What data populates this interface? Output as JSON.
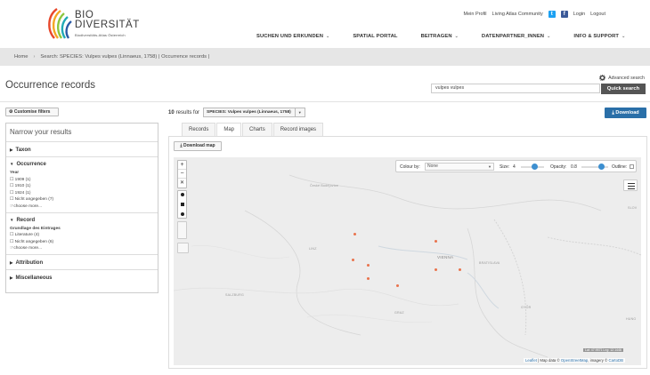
{
  "brand": {
    "name_line1": "BIO",
    "name_line2": "DIVERSITÄT",
    "subtitle": "Biodiversitäts-Atlas Österreich"
  },
  "util_nav": {
    "profile": "Mein Profil",
    "community": "Living Atlas Community",
    "twitter_glyph": "t",
    "facebook_glyph": "f",
    "login": "Login",
    "logout": "Logout"
  },
  "main_nav": {
    "items": [
      {
        "label": "SUCHEN UND ERKUNDEN",
        "chevron": "⌄"
      },
      {
        "label": "SPATIAL PORTAL",
        "chevron": ""
      },
      {
        "label": "BEITRAGEN",
        "chevron": "⌄"
      },
      {
        "label": "DATENPARTNER_INNEN",
        "chevron": "⌄"
      },
      {
        "label": "INFO & SUPPORT",
        "chevron": "⌄"
      }
    ]
  },
  "breadcrumb": {
    "home": "Home",
    "current": "Search: SPECIES: Vulpes vulpes (Linnaeus, 1758) | Occurrence records |"
  },
  "page": {
    "title": "Occurrence records"
  },
  "search": {
    "advanced_label": "Advanced search",
    "query": "vulpes vulpes",
    "button": "Quick search"
  },
  "sidebar": {
    "customise_label": "Customise filters",
    "narrow_title": "Narrow your results",
    "taxon": "Taxon",
    "occurrence": {
      "title": "Occurrence",
      "sub": "Year",
      "rows": [
        "1909 (1)",
        "1910 (1)",
        "1924 (1)",
        "Nicht angegeben (7)"
      ],
      "more": "choose more..."
    },
    "record": {
      "title": "Record",
      "sub": "Grundlage des Eintrages",
      "rows": [
        "Literature (4)",
        "Nicht angegeben (6)"
      ],
      "more": "choose more..."
    },
    "attribution": "Attribution",
    "misc": "Miscellaneous"
  },
  "results": {
    "count": "10",
    "suffix": "results for",
    "species": "SPECIES: Vulpes vulpes (Linnaeus, 1758)",
    "download": "Download"
  },
  "tabs": [
    "Records",
    "Map",
    "Charts",
    "Record images"
  ],
  "map": {
    "download_label": "Download map",
    "colour_by_label": "Colour by:",
    "colour_by_value": "None",
    "size_label": "Size:",
    "size_value": "4",
    "opacity_label": "Opacity:",
    "opacity_value": "0.8",
    "outline_label": "Outline:",
    "cities": [
      {
        "name": "České Budějovice",
        "major": false
      },
      {
        "name": "LINZ",
        "major": false
      },
      {
        "name": "VIENNA",
        "major": true
      },
      {
        "name": "BRATISLAVA",
        "major": false
      },
      {
        "name": "SALZBURG",
        "major": false
      },
      {
        "name": "GRAZ",
        "major": false
      },
      {
        "name": "GYŐR",
        "major": false
      },
      {
        "name": "SLOV",
        "major": false
      },
      {
        "name": "HUNG",
        "major": false
      }
    ],
    "scale_text": "Lat: 47.9571 Lng: 12.1446",
    "attribution_leaflet": "Leaflet",
    "attribution_mid": " | Map data © ",
    "attribution_osm": "OpenStreetMap",
    "attribution_img": ", imagery © ",
    "attribution_carto": "CartoDB",
    "point_color": "#e9724c"
  },
  "colors": {
    "accent_blue": "#2a6fa8",
    "breadcrumb_bg": "#e6e6e6",
    "quick_search_bg": "#555555"
  }
}
